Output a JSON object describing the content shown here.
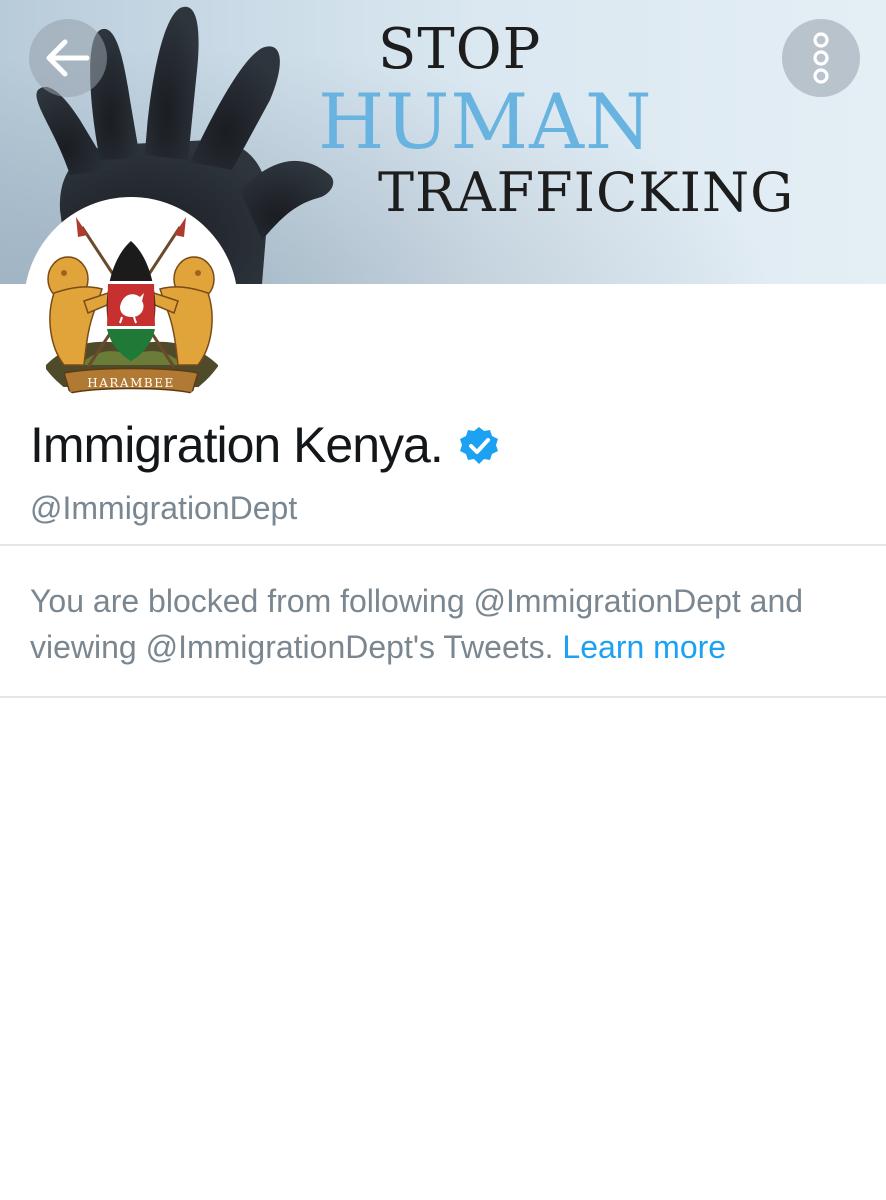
{
  "header": {
    "banner_lines": [
      "STOP",
      "HUMAN",
      "TRAFFICKING"
    ],
    "banner_colors": {
      "dark": "#1d1d1d",
      "accent": "#68b3e0"
    },
    "back_icon": "arrow-left-icon",
    "menu_icon": "vertical-dots-icon"
  },
  "profile": {
    "avatar_motto": "HARAMBEE",
    "display_name": "Immigration Kenya.",
    "verified_icon": "verified-badge-icon",
    "verified_color": "#1da1f2",
    "handle": "@ImmigrationDept"
  },
  "notice": {
    "text": "You are blocked from following @ImmigrationDept and viewing @ImmigrationDept's Tweets.",
    "link_label": "Learn more",
    "link_color": "#1da1f2"
  }
}
